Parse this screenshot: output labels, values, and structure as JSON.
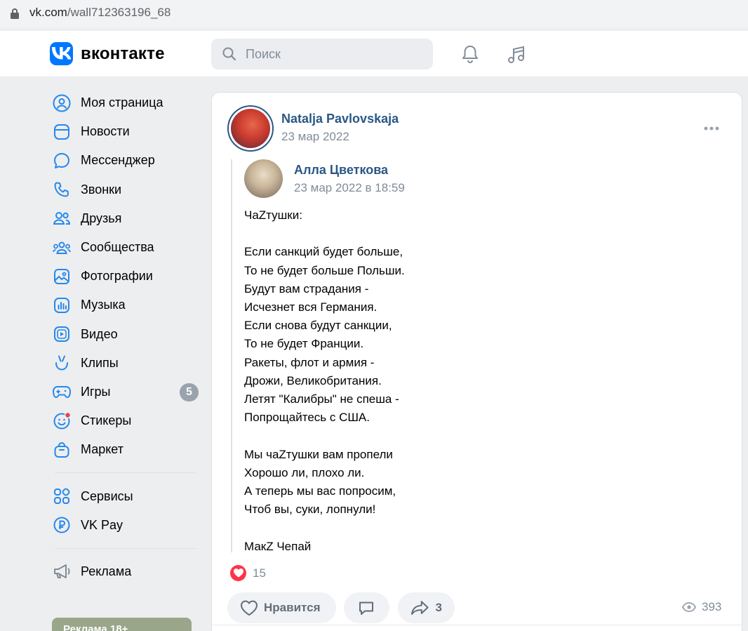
{
  "browser": {
    "url_host": "vk.com",
    "url_path": "/wall712363196_68"
  },
  "header": {
    "brand": "вконтакте",
    "search_placeholder": "Поиск",
    "icons": [
      "bell-icon",
      "music-icon"
    ]
  },
  "nav": {
    "items": [
      {
        "label": "Моя страница",
        "icon": "user-circle-icon"
      },
      {
        "label": "Новости",
        "icon": "news-icon"
      },
      {
        "label": "Мессенджер",
        "icon": "message-icon"
      },
      {
        "label": "Звонки",
        "icon": "phone-icon"
      },
      {
        "label": "Друзья",
        "icon": "friends-icon"
      },
      {
        "label": "Сообщества",
        "icon": "communities-icon"
      },
      {
        "label": "Фотографии",
        "icon": "photo-icon"
      },
      {
        "label": "Музыка",
        "icon": "music-list-icon"
      },
      {
        "label": "Видео",
        "icon": "video-icon"
      },
      {
        "label": "Клипы",
        "icon": "clips-icon"
      },
      {
        "label": "Игры",
        "icon": "gamepad-icon",
        "badge": "5"
      },
      {
        "label": "Стикеры",
        "icon": "sticker-icon"
      },
      {
        "label": "Маркет",
        "icon": "market-icon"
      }
    ],
    "secondary": [
      {
        "label": "Сервисы",
        "icon": "services-icon"
      },
      {
        "label": "VK Pay",
        "icon": "vkpay-icon"
      }
    ],
    "tertiary": [
      {
        "label": "Реклама",
        "icon": "megaphone-icon"
      }
    ],
    "promo_text": "Реклама 18+"
  },
  "post": {
    "author": "Natalja Pavlovskaja",
    "date": "23 мар 2022",
    "repost": {
      "author": "Алла Цветкова",
      "date": "23 мар 2022 в 18:59",
      "text": "ЧаZтушки:\n\nЕсли санкций будет больше,\nТо не будет больше Польши.\nБудут вам страдания -\nИсчезнет вся Германия.\nЕсли снова будут санкции,\nТо не будет Франции.\nРакеты, флот и армия -\nДрожи, Великобритания.\nЛетят \"Калибры\" не спеша -\nПопрощайтесь с США.\n\nМы чаZтушки вам пропели\nХорошо ли, плохо ли.\nА теперь мы вас попросим,\nЧтоб вы, суки, лопнули!\n\nМакZ Чепай"
    },
    "reactions_count": "15",
    "like_label": "Нравится",
    "share_count": "3",
    "views": "393"
  },
  "colors": {
    "accent": "#0077ff",
    "link": "#2a5885",
    "muted": "#818c99",
    "heart": "#ff3347"
  }
}
